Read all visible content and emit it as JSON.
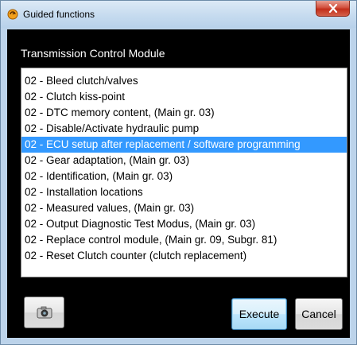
{
  "window": {
    "title": "Guided functions"
  },
  "module_title": "Transmission Control Module",
  "list": {
    "selected_index": 4,
    "items": [
      "02 - Bleed clutch/valves",
      "02 - Clutch kiss-point",
      "02 - DTC memory content, (Main gr. 03)",
      "02 - Disable/Activate hydraulic pump",
      "02 - ECU setup after replacement / software programming",
      "02 - Gear adaptation, (Main gr. 03)",
      "02 - Identification, (Main gr. 03)",
      "02 - Installation locations",
      "02 - Measured values, (Main gr. 03)",
      "02 - Output Diagnostic Test Modus, (Main gr. 03)",
      "02 - Replace control module, (Main gr. 09, Subgr. 81)",
      "02 - Reset Clutch counter (clutch replacement)"
    ]
  },
  "buttons": {
    "execute_label": "Execute",
    "cancel_label": "Cancel",
    "camera_icon": "camera-icon"
  },
  "colors": {
    "selection": "#3399ff",
    "client_background": "#000000",
    "frame": "#bcd3ea",
    "close_button": "#c22e1a"
  }
}
